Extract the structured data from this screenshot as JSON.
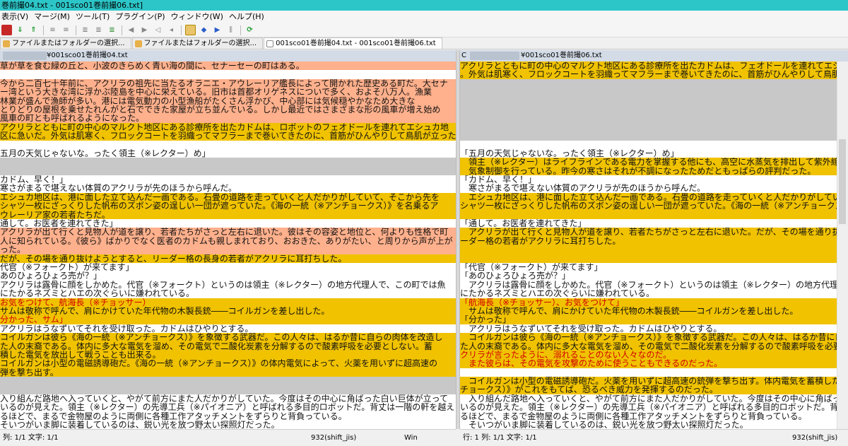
{
  "window": {
    "title": "巻前撮04.txt - 001sco01巻前撮06.txt]"
  },
  "menu": [
    "表示(V)",
    "マージ(M)",
    "ツール(T)",
    "プラグイン(P)",
    "ウィンドウ(W)",
    "ヘルプ(H)"
  ],
  "toolbar_icons": [
    "save-icon",
    "down-arrow-icon",
    "up-arrow-icon",
    "diff-first-icon",
    "diff-last-icon",
    "compare-icon",
    "merge-left-icon",
    "merge-right-icon",
    "toggle-icon",
    "copy-left-icon",
    "copy-right-icon",
    "prev-icon",
    "next-icon",
    "options-icon",
    "color-icon",
    "settings-icon",
    "refresh-icon"
  ],
  "tabs": [
    {
      "label": "ファイルまたはフォルダーの選択...",
      "active": false
    },
    {
      "label": "ファイルまたはフォルダーの選択...",
      "active": false
    },
    {
      "label": "001sco01巻前撮04.txt - 001sco01巻前撮06.txt",
      "active": true
    }
  ],
  "left_pane": {
    "path": "¥001sco01巻前撮04.txt",
    "lines": [
      {
        "t": "草が草を食む緑の丘と、小波のきらめく青い海の間に、セナーセーの町はある。",
        "bg": "p",
        "hl": "w"
      },
      {
        "t": "",
        "bg": "w"
      },
      {
        "t": "今から二百七十年前に、アクリラの祖先に当たるオラニエ・アウレーリア艦長によって開かれた歴史ある町だ。大セナ",
        "bg": "p"
      },
      {
        "t": "ー湾という大きな湾に浮かぶ陸島を中心に栄えている。旧市は首都オリゲネスについで多く、およそ八万人。漁業",
        "bg": "p"
      },
      {
        "t": "林業が盛んで漁師が多い。港には電気動力の小型漁船がたくさん浮かび、中心部には気候穏やかなため大きな",
        "bg": "p"
      },
      {
        "t": "とりどりの屋根を乗せたれんがと石でできた家屋が立ち並んでいる。しかし最近ではさまざまな形の風車が増え始め",
        "bg": "p"
      },
      {
        "t": "風車の町とも呼ばれるようになった。",
        "bg": "p"
      },
      {
        "t": "アクリラとともに町の中心のマルクト地区にある診療所を出たカドムは、ロボットのフェオドールを連れてエシュカ地",
        "bg": "c"
      },
      {
        "t": "区に急いだ。外気は肌寒く、フロックコートを羽織ってマフラーまで巻いてきたのに、首筋がひんやりして鳥肌が立った",
        "bg": "c"
      },
      {
        "t": "",
        "bg": "w"
      },
      {
        "t": "五月の天気じゃないな。ったく領主（※レクター）め」",
        "bg": "w"
      },
      {
        "t": "",
        "bg": "g"
      },
      {
        "t": "",
        "bg": "g"
      },
      {
        "t": "カドム、早く！」",
        "bg": "w"
      },
      {
        "t": "寒さがまるで堪えない体質のアクリラが先のほうから呼んだ。",
        "bg": "w"
      },
      {
        "t": "エシュカ地区は、港に面した立て込んだ一画である。石畳の道路を走っていくと人だかりがしていて、そこから先を",
        "bg": "c"
      },
      {
        "t": "シャツ一枚にざっくりした帆布のズボン姿の逞しい一団が遮っていた。《海の一統（※アンチョークス）》を名乗るア",
        "bg": "c"
      },
      {
        "t": "ウレーリア家の若者たちだ。",
        "bg": "c"
      },
      {
        "t": "通して。お医者を連れてきた」",
        "bg": "w"
      },
      {
        "t": "アクリラが出て行くと見物人が道を譲り、若者たちがさっと左右に退いた。彼はその容姿と地位と、何よりも性格で町",
        "bg": "p"
      },
      {
        "t": "人に知られている。《彼ら》ばかりでなく医者のカドムも親しまれており、おおきた、ありがたい、と周りから声が上が",
        "bg": "p"
      },
      {
        "t": "った。",
        "bg": "p"
      },
      {
        "t": "だが、その場を通り抜けようとすると、リーダー格の長身の若者がアクリラに耳打ちした。",
        "bg": "c"
      },
      {
        "t": "代官（※フォークト）が来てます」",
        "bg": "w"
      },
      {
        "t": "あのひょろひょろ売が？」",
        "bg": "w"
      },
      {
        "t": "アクリラは露骨に顔をしかめた。代官（※フォークト）というのは領主（※レクター）の地方代理人で、この町では魚",
        "bg": "w"
      },
      {
        "t": "にたかるネズミとハエの次ぐらいに嫌われている。",
        "bg": "w"
      },
      {
        "t": "お気をつけて、航海長（※チョッサー）",
        "bg": "c",
        "red": true
      },
      {
        "t": "サムは敬称で呼んで、肩にかけていた年代物の木製長銃――コイルガンを差し出した。",
        "bg": "c"
      },
      {
        "t": "分かった、サム」",
        "bg": "c",
        "red": true
      },
      {
        "t": "アクリラはうなずいてそれを受け取った。カドムはひやりとする。",
        "bg": "w"
      },
      {
        "t": "コイルガンは彼ら《海の一統（※アンチョークス）》を象徴する武器だ。この人々は、はるか昔に自らの肉体を改造し",
        "bg": "c"
      },
      {
        "t": "た人の末裔である。体内に多大な電気を溜め、その電気で二酸化炭素を分解するので酸素呼吸を必要としない。蓄",
        "bg": "c"
      },
      {
        "t": "積した電気を放出して戦うことも出来る。",
        "bg": "c"
      },
      {
        "t": "コイルガンは小型の電磁誘導砲だ。《海の一統（※アンチョークス）》の体内電気によって、火薬を用いずに超高速の",
        "bg": "c"
      },
      {
        "t": "弾を撃ち出す。",
        "bg": "c"
      },
      {
        "t": "",
        "bg": "g"
      },
      {
        "t": "",
        "bg": "g"
      },
      {
        "t": "入り組んだ路地へ入っていくと、やがて前方にまた人だかりがしていた。今度はその中心に角ばった白い巨体が立って",
        "bg": "w"
      },
      {
        "t": "いるのが見えた。領主（※レクター）の先導工兵（※パイオニア）と呼ばれる多目的ロボットだ。背丈は一階の軒を越え",
        "bg": "w"
      },
      {
        "t": "るほどで、まるで金物屋のように両側に各種工作アタッチメントをずらりと背負っている。",
        "bg": "w"
      },
      {
        "t": "そいつがいま脚に装着しているのは、鋭い光を放つ野太い探照灯だった。",
        "bg": "w"
      }
    ]
  },
  "right_pane": {
    "path": "¥001sco01巻前撮06.txt",
    "lines": [
      {
        "t": "アクリラとともに町の中心のマルクト地区にある診療所を出たカドムは、フェオドールを連れてエシ",
        "bg": "c"
      },
      {
        "t": "。外気は肌寒く、フロックコートを羽織ってマフラーまで巻いてきたのに、首筋がひんやりして鳥肌が",
        "bg": "c"
      },
      {
        "t": "",
        "bg": "g"
      },
      {
        "t": "",
        "bg": "g"
      },
      {
        "t": "",
        "bg": "g"
      },
      {
        "t": "",
        "bg": "g"
      },
      {
        "t": "",
        "bg": "g"
      },
      {
        "t": "",
        "bg": "g"
      },
      {
        "t": "",
        "bg": "g"
      },
      {
        "t": "",
        "bg": "w"
      },
      {
        "t": "「五月の天気じゃないな。ったく領主（※レクター）め」",
        "bg": "w"
      },
      {
        "t": "　領主（※レクター）はライフラインである電力を掌握する他にも、高空に水蒸気を排出して紫外線を",
        "bg": "c"
      },
      {
        "t": "　気象制御を行っている。昨今の寒さはそれが不調になったためだともっぱらの評判だった。",
        "bg": "c"
      },
      {
        "t": "「カドム、早く！」",
        "bg": "w"
      },
      {
        "t": "　寒さがまるで堪えない体質のアクリラが先のほうから呼んだ。",
        "bg": "w"
      },
      {
        "t": "　エシュカ地区は、港に面した立て込んだ一画である。石畳の道路を走っていくと人だかりがしていて",
        "bg": "c"
      },
      {
        "t": "シャツ一枚にざっくりした帆布のズボン姿の逞しい一団が遮っていた。《海の一統（※アンチョークス",
        "bg": "c"
      },
      {
        "t": "",
        "bg": "c"
      },
      {
        "t": "「通して。お医者を連れてきた」",
        "bg": "w"
      },
      {
        "t": "　アクリラが出て行くと見物人が道を譲り、若者たちがさっと左右に退いた。だが、その場を通り抜け",
        "bg": "c"
      },
      {
        "t": "ーダー格の若者がアクリラに耳打ちした。",
        "bg": "c"
      },
      {
        "t": "",
        "bg": "c"
      },
      {
        "t": "",
        "bg": "c"
      },
      {
        "t": "「代官（※フォークト）が来てます」",
        "bg": "w"
      },
      {
        "t": "「あのひょろひょろ売が？」",
        "bg": "w"
      },
      {
        "t": "　アクリラは露骨に顔をしかめた。代官（※フォークト）というのは領主（※レクター）の地方代理人",
        "bg": "w"
      },
      {
        "t": "にたかるネズミとハエの次ぐらいに嫌われている。",
        "bg": "w"
      },
      {
        "t": "「航海長（※チョッサー）、お気をつけて」",
        "bg": "c",
        "red": true
      },
      {
        "t": "　サムは敬称で呼んで、肩にかけていた年代物の木製長銃――コイルガンを差し出した。",
        "bg": "c"
      },
      {
        "t": "「分かった」",
        "bg": "c"
      },
      {
        "t": "　アクリラはうなずいてそれを受け取った。カドムはひやりとする。",
        "bg": "w"
      },
      {
        "t": "　コイルガンは彼ら《海の一統（※アンチョークス）》を象徴する武器だ。この人々は、はるか昔に自",
        "bg": "c"
      },
      {
        "t": "た人の末裔である。体内に多大な電気を溜め、その電気で二酸化炭素を分解するので酸素呼吸を必要",
        "bg": "c"
      },
      {
        "t": "クリラが言ったように、溺れることのない人々なのだ。",
        "bg": "c",
        "red": true
      },
      {
        "t": "　また彼らは、その電気を攻撃のために使うこともできるのだった。",
        "bg": "c",
        "red": true
      },
      {
        "t": "",
        "bg": "w"
      },
      {
        "t": "　コイルガンは小型の電磁誘導砲だ。火薬を用いずに超高速の銃弾を撃ち出す。体内電気を蓄積した",
        "bg": "c"
      },
      {
        "t": "チョークス）》がこれをもてば、恐るべき威力を発揮するのだった。",
        "bg": "c"
      },
      {
        "t": "　入り組んだ路地へ入っていくと、やがて前方にまた人だかりがしていた。今度はその中心に角ばった",
        "bg": "w"
      },
      {
        "t": "いるのが見えた。領主（※レクター）の先導工兵（※パイオニア）と呼ばれる多目的ロボットだ。背",
        "bg": "w"
      },
      {
        "t": "るほどで、まるで金物屋のように両側に各種工作アタッチメントをずらりと背負っている。",
        "bg": "w"
      },
      {
        "t": "　そいつがいま脚に装着しているのは、鋭い光を放つ野太い探照灯だった。",
        "bg": "w"
      }
    ]
  },
  "status_left": {
    "pos": "列: 1/1  文字: 1/1",
    "encoding": "932(shift_jis)",
    "eol": "Win"
  },
  "status_right": {
    "pos": "行: 1 列: 1/1  文字: 1/1",
    "encoding": "932(shift_jis)"
  },
  "colors": {
    "changed": "#f0c200",
    "moved": "#ffb08c",
    "missing": "#c8c8c8",
    "titlebar": "#2dc6c8"
  }
}
